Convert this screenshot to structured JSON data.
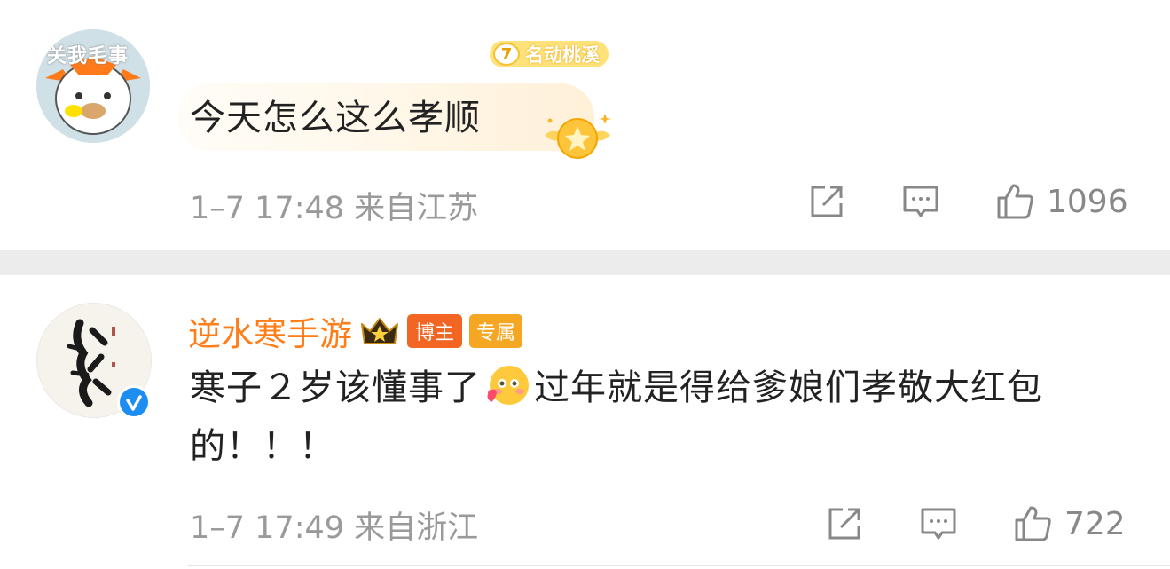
{
  "comments": [
    {
      "avatar_overlay_text": "关我毛事",
      "level": "7",
      "level_title": "名动桃溪",
      "text": "今天怎么这么孝顺",
      "time": "1–7 17:48",
      "location": "来自江苏",
      "likes": "1096"
    },
    {
      "username": "逆水寒手游",
      "tag_blogger": "博主",
      "tag_exclusive": "专属",
      "text_before_emoji": "寒子２岁该懂事了",
      "emoji": "hearts-face-emoji",
      "text_after_emoji": "过年就是得给爹娘们孝敬大红包的！！！",
      "time": "1–7 17:49",
      "location": "来自浙江",
      "likes": "722",
      "verified": true
    }
  ],
  "colors": {
    "username": "#ff7e1a",
    "meta_gray": "#9a9a9a",
    "divider": "#ececec",
    "verified_blue": "#1d8df2"
  },
  "icons": [
    "share-icon",
    "reply-icon",
    "like-icon",
    "crown-icon",
    "verified-icon",
    "level-star-icon"
  ]
}
